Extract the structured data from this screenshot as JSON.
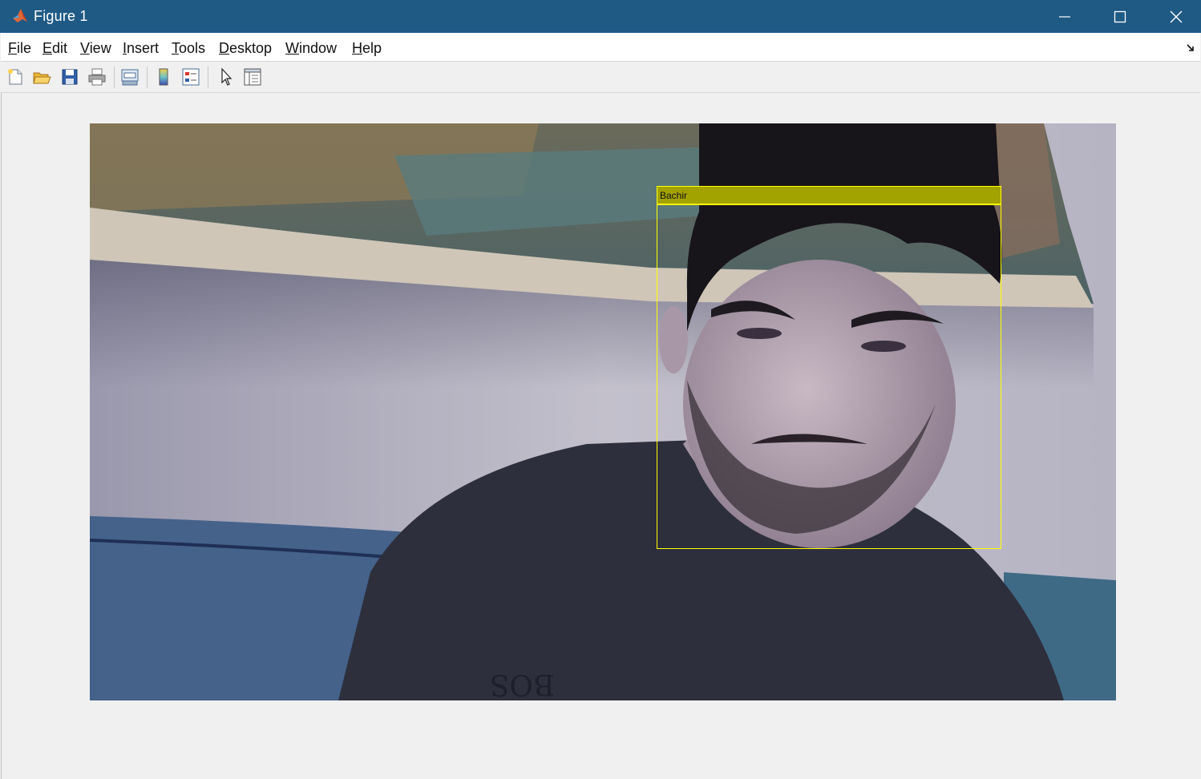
{
  "window": {
    "title": "Figure 1",
    "app_icon": "matlab-icon",
    "controls": [
      "minimize-icon",
      "maximize-icon",
      "close-icon"
    ]
  },
  "menu": {
    "items": [
      {
        "label": "File",
        "underline": "F",
        "rest": "ile"
      },
      {
        "label": "Edit",
        "underline": "E",
        "rest": "dit"
      },
      {
        "label": "View",
        "underline": "V",
        "rest": "iew"
      },
      {
        "label": "Insert",
        "underline": "I",
        "rest": "nsert"
      },
      {
        "label": "Tools",
        "underline": "T",
        "rest": "ools"
      },
      {
        "label": "Desktop",
        "underline": "D",
        "rest": "esktop"
      },
      {
        "label": "Window",
        "underline": "W",
        "rest": "indow"
      },
      {
        "label": "Help",
        "underline": "H",
        "rest": "elp"
      }
    ],
    "dock_icon": "undock-arrow-icon"
  },
  "toolbar": {
    "buttons": [
      "new-figure-icon",
      "open-file-icon",
      "save-icon",
      "print-icon",
      "link-plot-icon",
      "insert-colorbar-icon",
      "insert-legend-icon",
      "edit-plot-arrow-icon",
      "property-inspector-icon"
    ]
  },
  "figure": {
    "image_description_icon": "webcam-frame-image",
    "detection": {
      "label": "Bachir",
      "box_color": "#ffff00",
      "label_bg": "#a3a300"
    }
  },
  "colors": {
    "titlebar": "#1f5a85",
    "background": "#f0f0f0"
  }
}
